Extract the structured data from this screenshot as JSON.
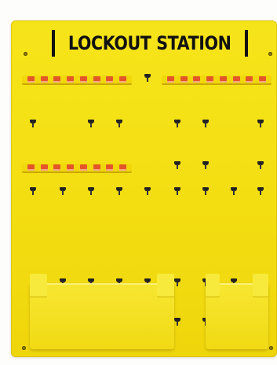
{
  "board": {
    "title": "LOCKOUT STATION",
    "board_color": "#f3de12",
    "tag_color": "#e4552a",
    "hook_color": "#222222"
  }
}
